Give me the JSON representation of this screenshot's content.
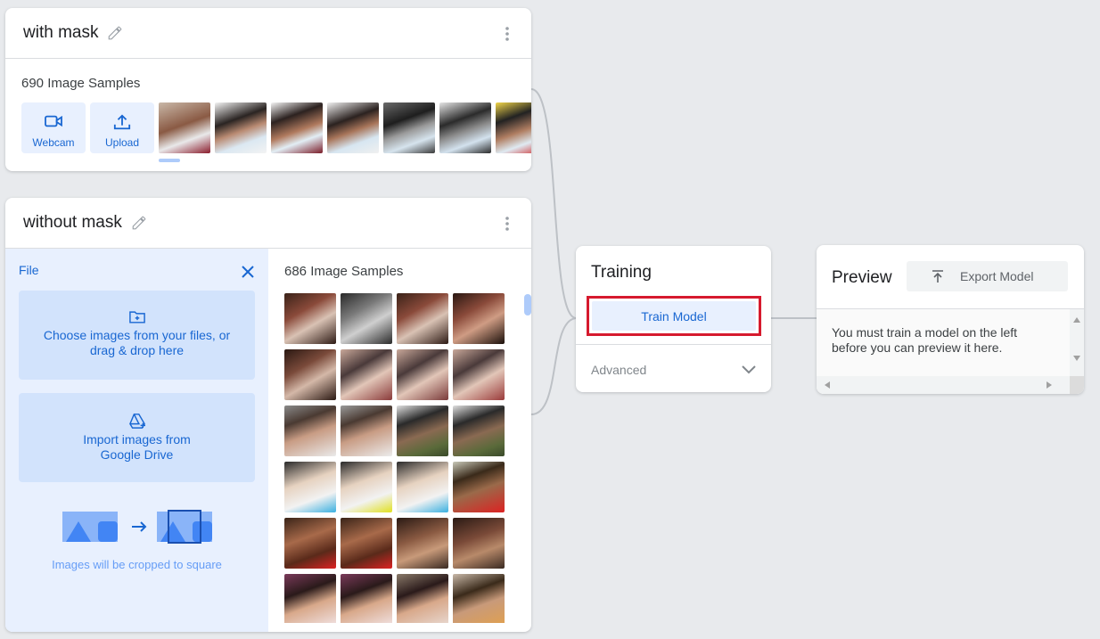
{
  "classes": [
    {
      "title": "with mask",
      "samples": "690 Image Samples",
      "webcam_label": "Webcam",
      "upload_label": "Upload"
    },
    {
      "title": "without mask",
      "samples": "686 Image Samples",
      "file_label": "File",
      "choose_files_text": "Choose images from your files, or drag & drop here",
      "drive_text": "Import images from Google Drive",
      "crop_note": "Images will be cropped to square"
    }
  ],
  "training": {
    "title": "Training",
    "train_button": "Train Model",
    "advanced_label": "Advanced"
  },
  "preview": {
    "title": "Preview",
    "export_button": "Export Model",
    "message": "You must train a model on the left before you can preview it here."
  },
  "colors": {
    "accent": "#1967d2",
    "highlight": "#d61a2e",
    "panel": "#e8f0fe"
  }
}
